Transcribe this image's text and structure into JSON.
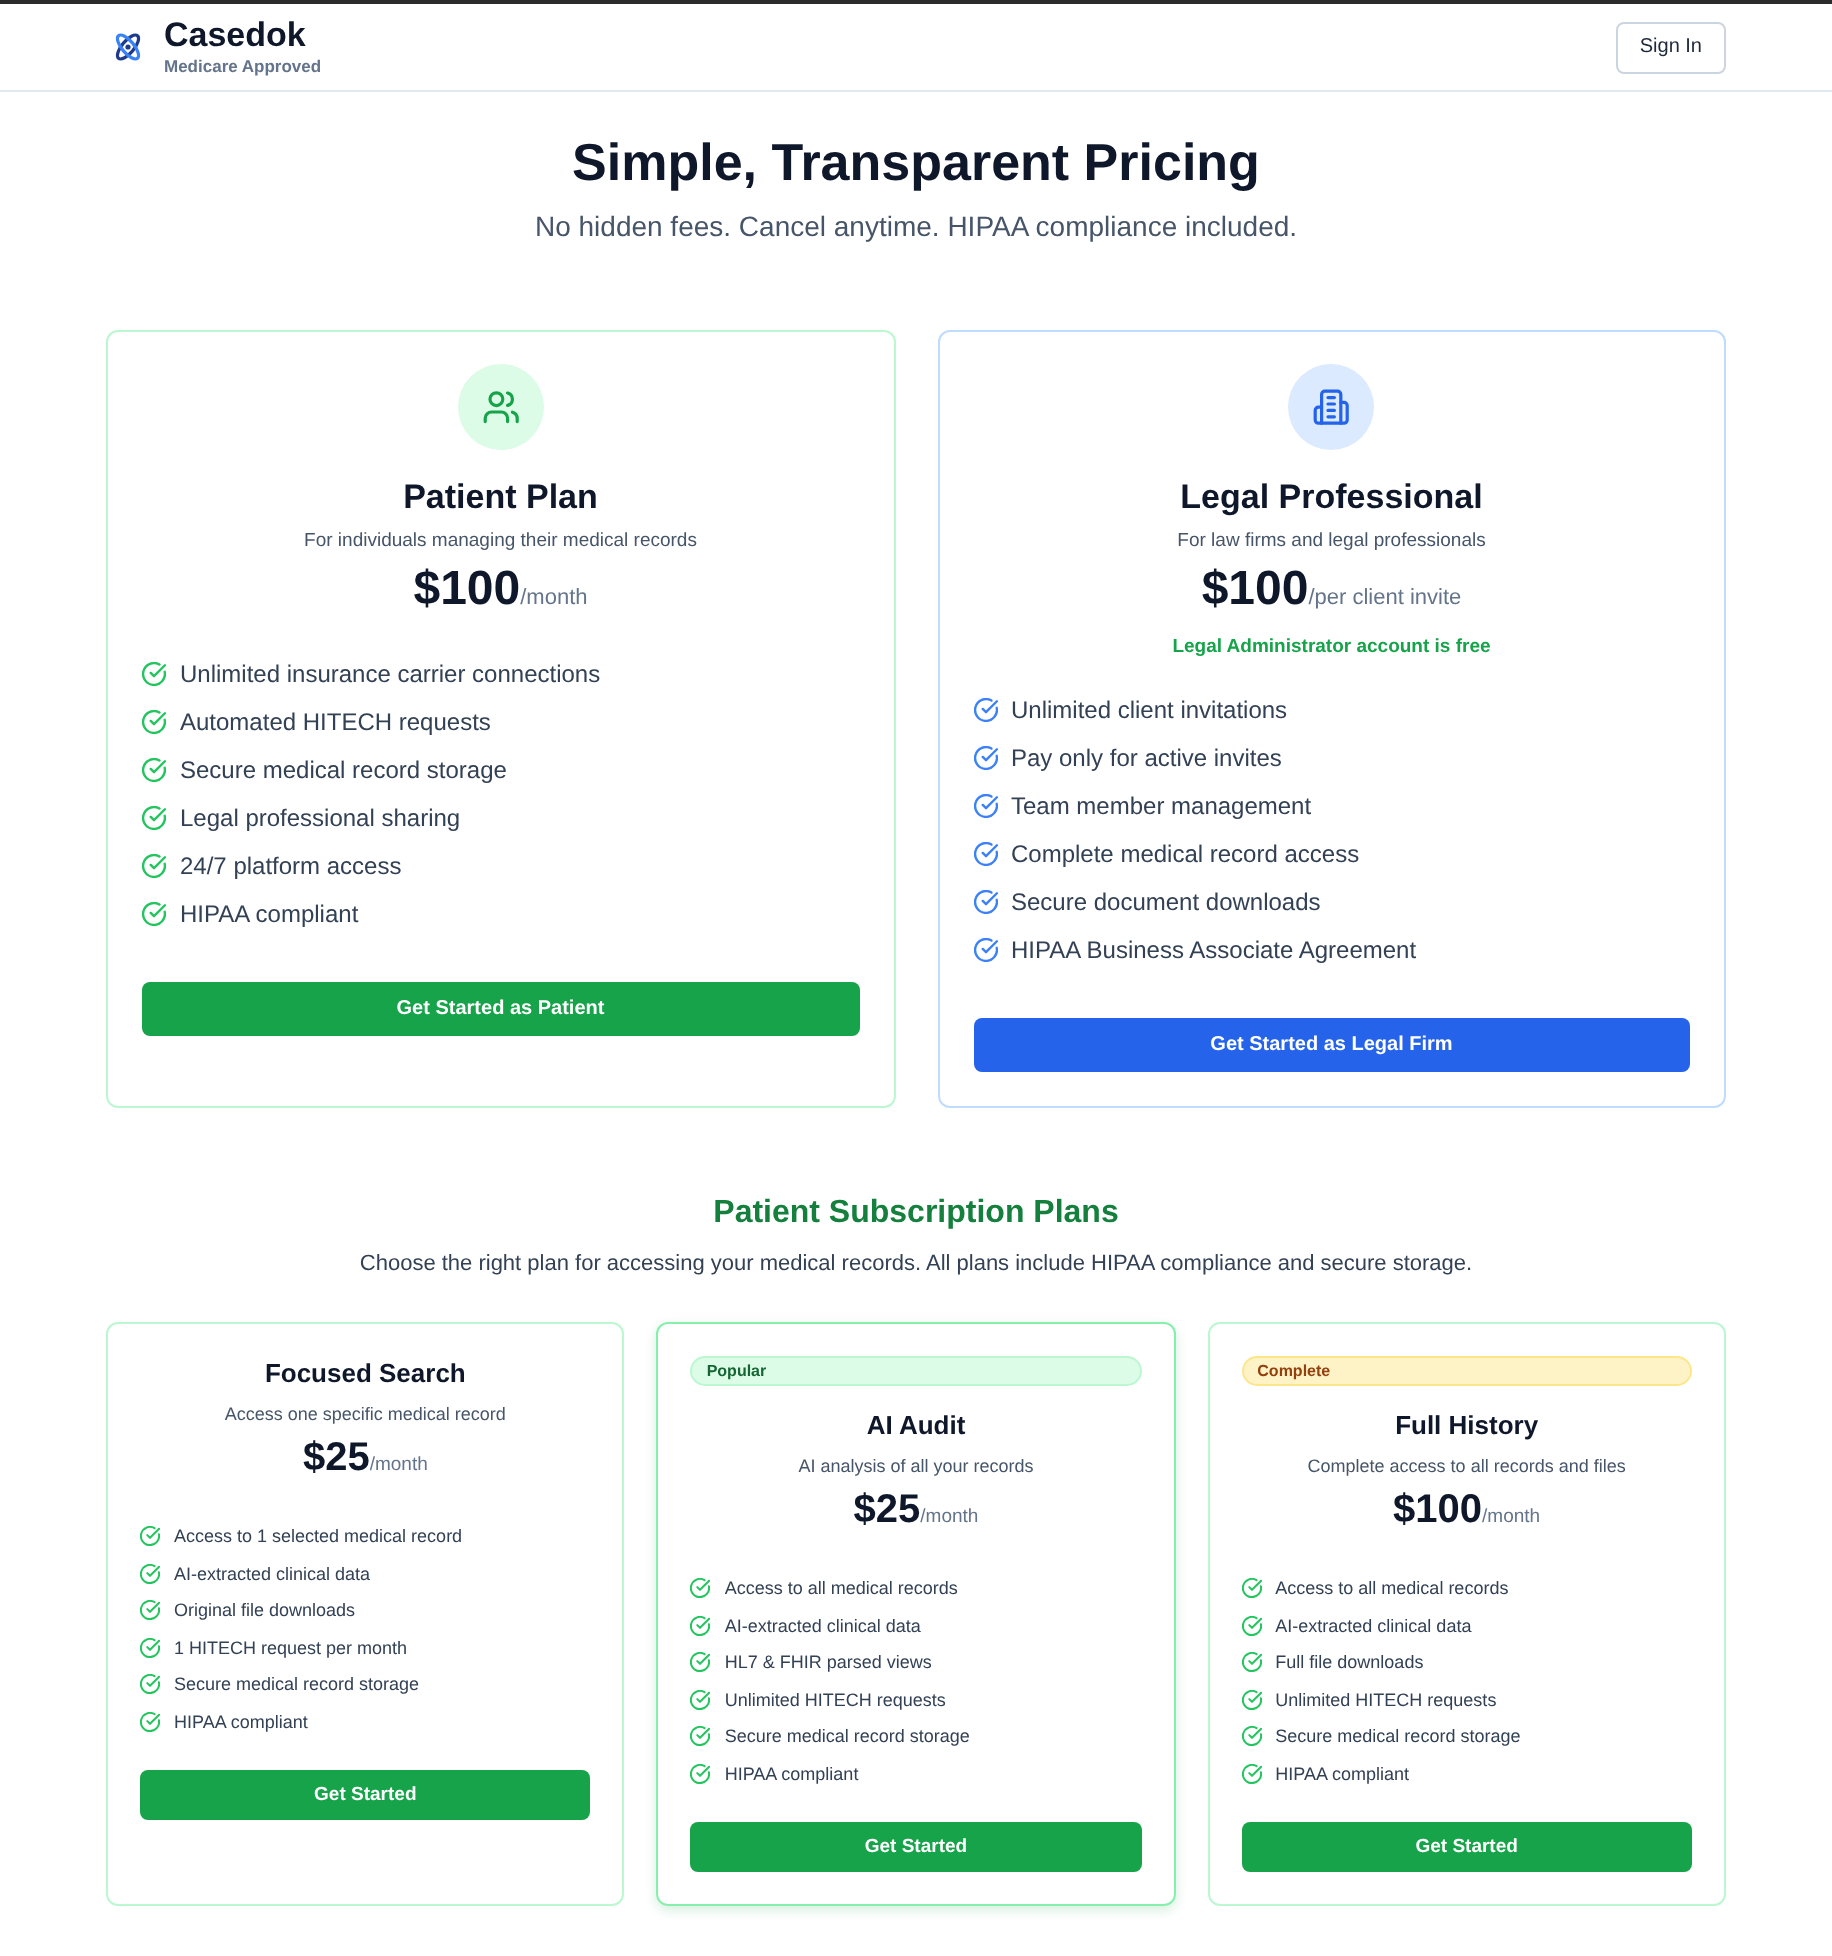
{
  "header": {
    "brand": "Casedok",
    "tagline": "Medicare Approved",
    "sign_in": "Sign In"
  },
  "hero": {
    "title": "Simple, Transparent Pricing",
    "subtitle": "No hidden fees. Cancel anytime. HIPAA compliance included."
  },
  "main_plans": [
    {
      "kind": "patient",
      "title": "Patient Plan",
      "description": "For individuals managing their medical records",
      "price": "$100",
      "period": "/month",
      "features": [
        "Unlimited insurance carrier connections",
        "Automated HITECH requests",
        "Secure medical record storage",
        "Legal professional sharing",
        "24/7 platform access",
        "HIPAA compliant"
      ],
      "button": "Get Started as Patient"
    },
    {
      "kind": "legal",
      "title": "Legal Professional",
      "description": "For law firms and legal professionals",
      "price": "$100",
      "period": "/per client invite",
      "note": "Legal Administrator account is free",
      "features": [
        "Unlimited client invitations",
        "Pay only for active invites",
        "Team member management",
        "Complete medical record access",
        "Secure document downloads",
        "HIPAA Business Associate Agreement"
      ],
      "button": "Get Started as Legal Firm"
    }
  ],
  "subscription": {
    "title": "Patient Subscription Plans",
    "subtitle": "Choose the right plan for accessing your medical records. All plans include HIPAA compliance and secure storage.",
    "plans": [
      {
        "title": "Focused Search",
        "featured": false,
        "description": "Access one specific medical record",
        "price": "$25",
        "period": "/month",
        "features": [
          "Access to 1 selected medical record",
          "AI-extracted clinical data",
          "Original file downloads",
          "1 HITECH request per month",
          "Secure medical record storage",
          "HIPAA compliant"
        ],
        "button": "Get Started"
      },
      {
        "badge": {
          "label": "Popular",
          "kind": "popular"
        },
        "title": "AI Audit",
        "featured": true,
        "description": "AI analysis of all your records",
        "price": "$25",
        "period": "/month",
        "features": [
          "Access to all medical records",
          "AI-extracted clinical data",
          "HL7 & FHIR parsed views",
          "Unlimited HITECH requests",
          "Secure medical record storage",
          "HIPAA compliant"
        ],
        "button": "Get Started"
      },
      {
        "badge": {
          "label": "Complete",
          "kind": "complete"
        },
        "title": "Full History",
        "featured": false,
        "description": "Complete access to all records and files",
        "price": "$100",
        "period": "/month",
        "features": [
          "Access to all medical records",
          "AI-extracted clinical data",
          "Full file downloads",
          "Unlimited HITECH requests",
          "Secure medical record storage",
          "HIPAA compliant"
        ],
        "button": "Get Started"
      }
    ]
  }
}
